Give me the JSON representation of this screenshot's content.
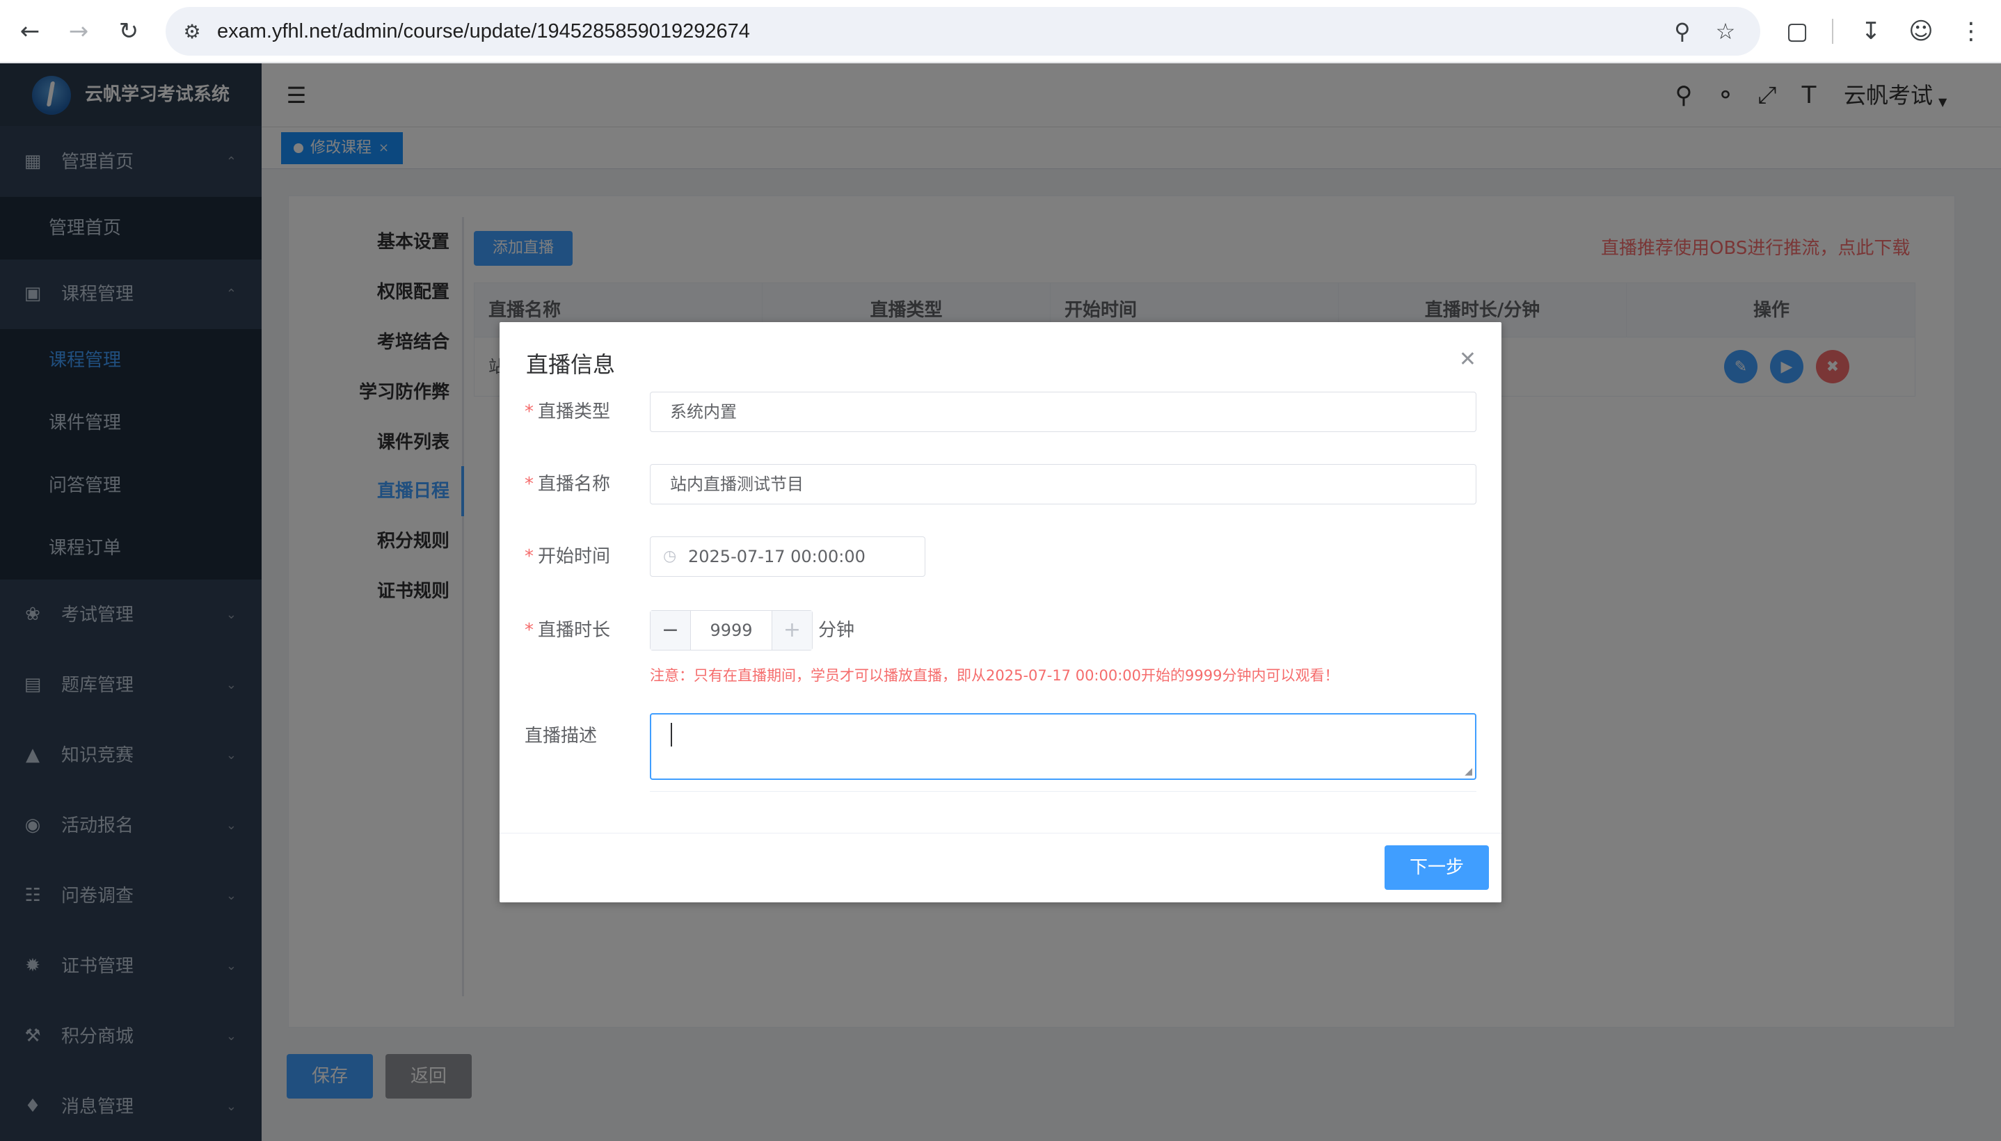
{
  "browser": {
    "url": "exam.yfhl.net/admin/course/update/1945285859019292674"
  },
  "sidebar": {
    "app_title": "云帆学习考试系统",
    "groups": [
      {
        "label": "管理首页",
        "icon": "dashboard-icon",
        "expanded": true,
        "children": [
          "管理首页"
        ]
      },
      {
        "label": "课程管理",
        "icon": "monitor-icon",
        "expanded": true,
        "children": [
          "课程管理",
          "课件管理",
          "问答管理",
          "课程订单"
        ]
      },
      {
        "label": "考试管理",
        "icon": "exam-icon",
        "expanded": false
      },
      {
        "label": "题库管理",
        "icon": "document-icon",
        "expanded": false
      },
      {
        "label": "知识竞赛",
        "icon": "fire-icon",
        "expanded": false
      },
      {
        "label": "活动报名",
        "icon": "target-icon",
        "expanded": false
      },
      {
        "label": "问卷调查",
        "icon": "book-icon",
        "expanded": false
      },
      {
        "label": "证书管理",
        "icon": "certificate-icon",
        "expanded": false
      },
      {
        "label": "积分商城",
        "icon": "cart-icon",
        "expanded": false
      },
      {
        "label": "消息管理",
        "icon": "bell-icon",
        "expanded": false
      }
    ],
    "active_item": "课程管理"
  },
  "navbar": {
    "user_name": "云帆考试"
  },
  "tags": {
    "active_tag": "修改课程"
  },
  "course_tabs": [
    "基本设置",
    "权限配置",
    "考培结合",
    "学习防作弊",
    "课件列表",
    "直播日程",
    "积分规则",
    "证书规则"
  ],
  "active_course_tab": "直播日程",
  "live": {
    "add_button": "添加直播",
    "obs_notice": "直播推荐使用OBS进行推流，点此下载",
    "columns": [
      "直播名称",
      "直播类型",
      "开始时间",
      "直播时长/分钟",
      "操作"
    ],
    "row_first_char": "站"
  },
  "footer": {
    "save": "保存",
    "back": "返回"
  },
  "dialog": {
    "title": "直播信息",
    "type_label": "直播类型",
    "type_value": "系统内置",
    "name_label": "直播名称",
    "name_value": "站内直播测试节目",
    "start_label": "开始时间",
    "start_value": "2025-07-17 00:00:00",
    "duration_label": "直播时长",
    "duration_value": "9999",
    "duration_unit": "分钟",
    "notice": "注意：只有在直播期间，学员才可以播放直播，即从2025-07-17 00:00:00开始的9999分钟内可以观看！",
    "desc_label": "直播描述",
    "desc_value": "",
    "next_button": "下一步"
  },
  "colors": {
    "primary": "#409eff",
    "danger": "#f56c6c",
    "sidebar_bg": "#304156"
  }
}
